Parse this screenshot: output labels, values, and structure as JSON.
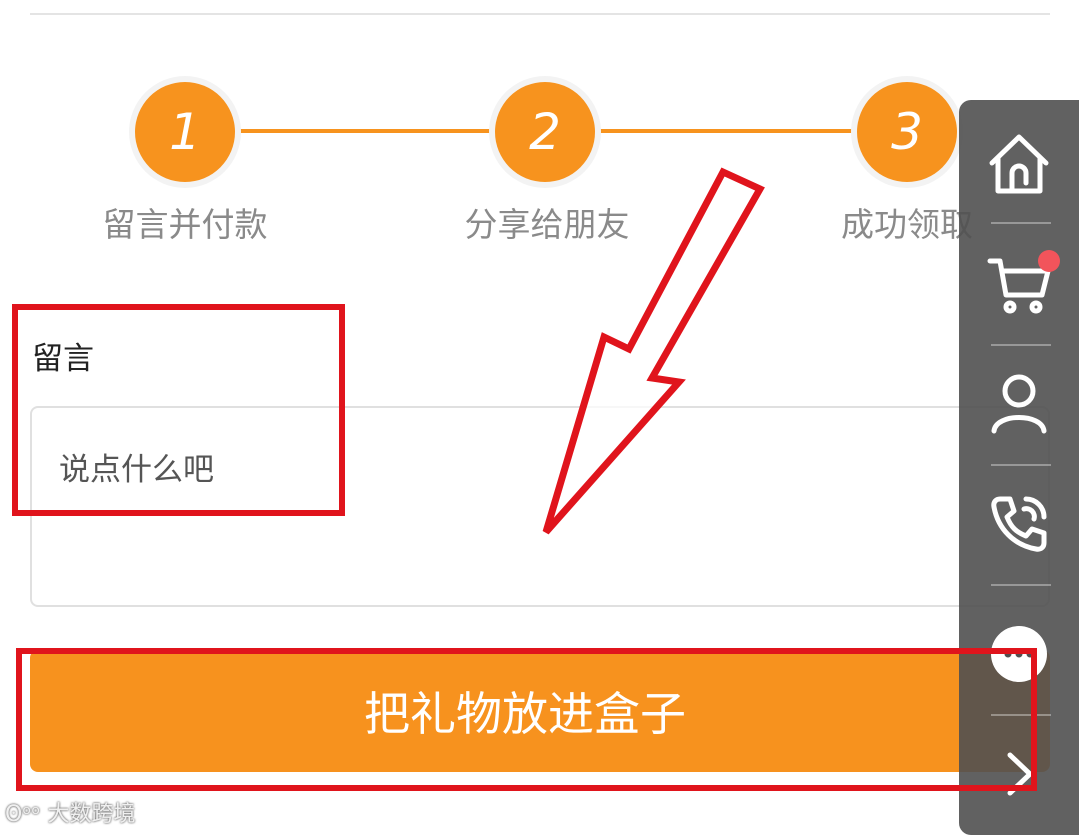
{
  "steps": [
    {
      "number": "1",
      "label": "留言并付款"
    },
    {
      "number": "2",
      "label": "分享给朋友"
    },
    {
      "number": "3",
      "label": "成功领取"
    }
  ],
  "message": {
    "label": "留言",
    "placeholder": "说点什么吧"
  },
  "submit_button": "把礼物放进盒子",
  "toolbar": {
    "items": [
      {
        "icon": "home-icon"
      },
      {
        "icon": "cart-icon",
        "badge": true
      },
      {
        "icon": "user-icon"
      },
      {
        "icon": "phone-icon"
      },
      {
        "icon": "chat-icon"
      },
      {
        "icon": "chevron-right-icon"
      }
    ]
  },
  "watermark": "大数跨境",
  "colors": {
    "accent": "#f7931e",
    "annotation": "#e0141c",
    "toolbar": "#505050"
  }
}
